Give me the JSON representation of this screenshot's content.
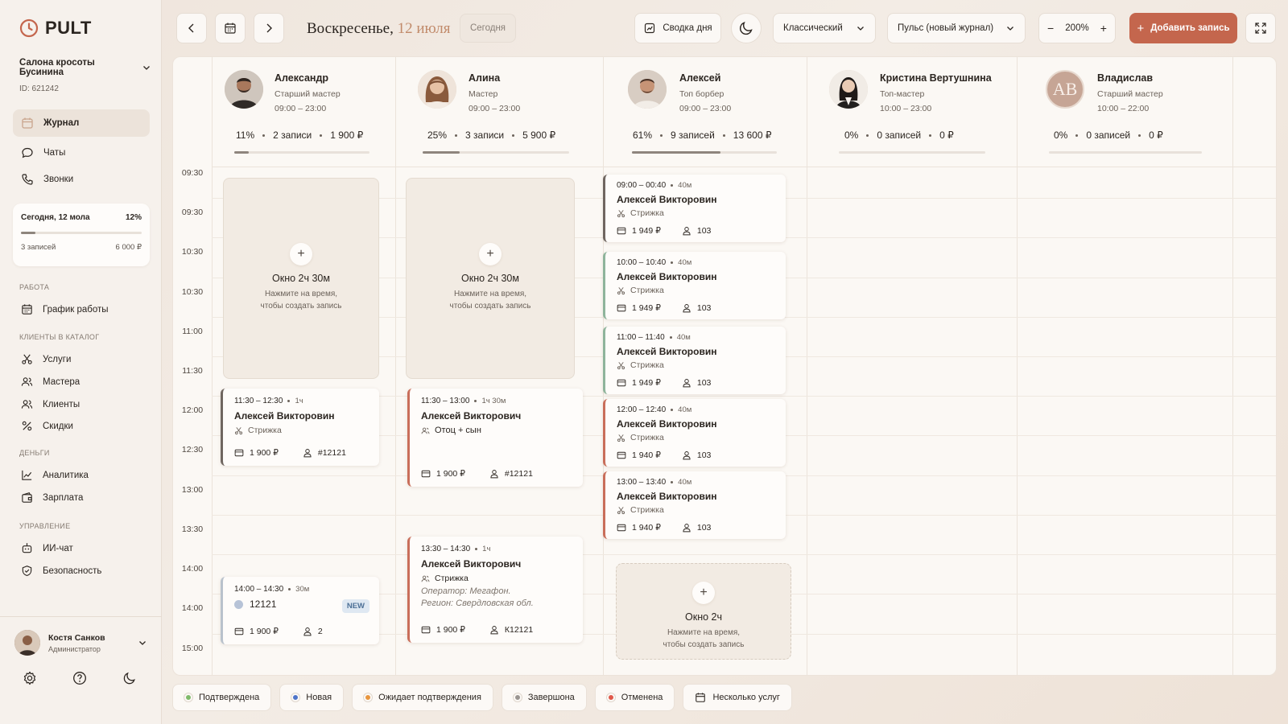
{
  "app": {
    "logo": "PULT"
  },
  "salon": {
    "name": "Салона кросоты Бусинина",
    "id": "ID: 621242"
  },
  "nav": {
    "journal": "Журнал",
    "chats": "Чаты",
    "calls": "Звонки"
  },
  "today_card": {
    "title": "Сегодня, 12 мола",
    "percent": "12%",
    "progress": 0.12,
    "records": "3 записей",
    "amount": "6 000 ₽"
  },
  "sections": {
    "work": "РАБОТА",
    "clients": "КЛИЕНТЫ В КАТАЛОГ",
    "money": "ДЕНЬГИ",
    "management": "УПРАВЛЕНИЕ"
  },
  "menu": {
    "schedule": "График работы",
    "services": "Услуги",
    "masters": "Мастера",
    "clients": "Клиенты",
    "discounts": "Скидки",
    "analytics": "Аналитика",
    "salary": "Зарплата",
    "ai_chat": "ИИ-чат",
    "security": "Безопасность"
  },
  "user": {
    "name": "Костя Санков",
    "role": "Администратор"
  },
  "toolbar": {
    "date_weekday": "Воскресенье,",
    "date_day": "12 июля",
    "today_label": "Сегодня",
    "day_summary": "Сводка дня",
    "view_mode": "Классический",
    "journal_mode": "Пульс (новый журнал)",
    "zoom": "200%",
    "add_record": "Добавить запись"
  },
  "times": [
    "09:30",
    "09:30",
    "10:30",
    "10:30",
    "11:00",
    "11:30",
    "12:00",
    "12:30",
    "13:00",
    "13:30",
    "14:00",
    "14:00",
    "15:00"
  ],
  "staff": [
    {
      "name": "Александр",
      "role": "Старший мастер",
      "hours": "09:00 – 23:00",
      "percent": "11%",
      "progress": 0.11,
      "records": "2 записи",
      "amount": "1 900 ₽"
    },
    {
      "name": "Алина",
      "role": "Мастер",
      "hours": "09:00 – 23:00",
      "percent": "25%",
      "progress": 0.25,
      "records": "3 записи",
      "amount": "5 900 ₽"
    },
    {
      "name": "Алексей",
      "role": "Топ борбер",
      "hours": "09:00 – 23:00",
      "percent": "61%",
      "progress": 0.61,
      "records": "9 записей",
      "amount": "13 600 ₽"
    },
    {
      "name": "Кристина Вертушнина",
      "role": "Топ-мастер",
      "hours": "10:00 – 23:00",
      "percent": "0%",
      "progress": 0,
      "records": "0 записей",
      "amount": "0 ₽"
    },
    {
      "name": "Владислав",
      "role": "Старший мастер",
      "hours": "10:00 – 22:00",
      "percent": "0%",
      "progress": 0,
      "records": "0 записей",
      "amount": "0 ₽",
      "initials": "AB"
    }
  ],
  "slots": {
    "s1": {
      "title": "Окно 2ч 30м",
      "hint1": "Нажмите на время,",
      "hint2": "чтобы создать запись"
    },
    "s2": {
      "title": "Окно 2ч 30м",
      "hint1": "Нажмите на время,",
      "hint2": "чтобы создать запись"
    },
    "s3": {
      "title": "Окно 2ч",
      "hint1": "Нажмите на время,",
      "hint2": "чтобы создать запись"
    }
  },
  "appointments": {
    "a1": {
      "time": "11:30 – 12:30",
      "duration": "1ч",
      "name": "Алексей Викторовин",
      "service": "Стрижка",
      "price": "1 900 ₽",
      "client": "#12121"
    },
    "a2": {
      "time": "14:00 – 14:30",
      "duration": "30м",
      "name": "12121",
      "badge": "NEW",
      "price": "1 900 ₽",
      "client": "2"
    },
    "b1": {
      "time": "11:30 – 13:00",
      "duration": "1ч 30м",
      "name": "Алексей Викторович",
      "service": "Отоц + сын",
      "price": "1 900 ₽",
      "client": "#12121"
    },
    "b2": {
      "time": "13:30 – 14:30",
      "duration": "1ч",
      "name": "Алексей Викторович",
      "service": "Стрижка",
      "extra1": "Оператор: Мегафон.",
      "extra2": "Регион: Свердловская обл.",
      "price": "1 900 ₽",
      "client": "К12121"
    },
    "c1": {
      "time": "09:00 – 00:40",
      "duration": "40м",
      "name": "Алексей Викторовин",
      "service": "Стрижка",
      "price": "1 949 ₽",
      "client": "103"
    },
    "c2": {
      "time": "10:00 – 10:40",
      "duration": "40м",
      "name": "Алексей Викторовин",
      "service": "Стрижка",
      "price": "1 949 ₽",
      "client": "103"
    },
    "c3": {
      "time": "11:00 – 11:40",
      "duration": "40м",
      "name": "Алексей Викторовин",
      "service": "Стрижка",
      "price": "1 949 ₽",
      "client": "103"
    },
    "c4": {
      "time": "12:00 – 12:40",
      "duration": "40м",
      "name": "Алексей Викторовин",
      "service": "Стрижка",
      "price": "1 940 ₽",
      "client": "103"
    },
    "c5": {
      "time": "13:00 – 13:40",
      "duration": "40м",
      "name": "Алексей Викторовин",
      "service": "Стрижка",
      "price": "1 940 ₽",
      "client": "103"
    }
  },
  "legend": {
    "confirmed": "Подтверждена",
    "new": "Новая",
    "pending": "Ожидает подтверждения",
    "done": "Завершона",
    "cancelled": "Отменена",
    "multi": "Несколько услуг"
  },
  "colors": {
    "accent": "#c4664d",
    "confirmed": "#7fba6a",
    "new": "#4e74c9",
    "pending": "#e8963f",
    "done": "#9a9591",
    "cancelled": "#e0584a"
  }
}
